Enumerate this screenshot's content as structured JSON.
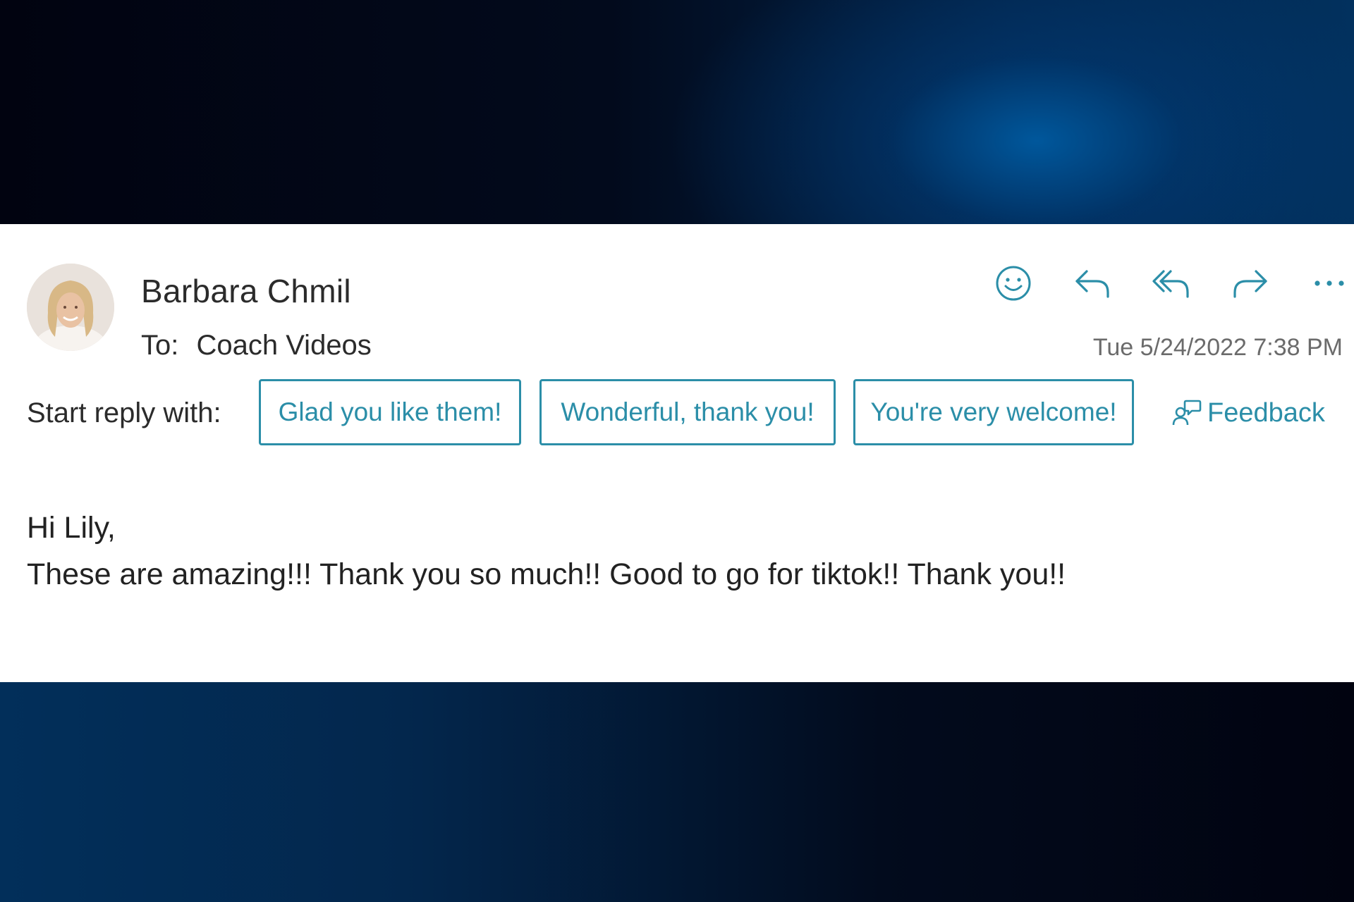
{
  "message": {
    "sender_name": "Barbara Chmil",
    "to_label": "To:",
    "to_value": "Coach Videos",
    "timestamp": "Tue 5/24/2022 7:38 PM"
  },
  "actions": [
    {
      "icon": "emoji-icon"
    },
    {
      "icon": "reply-icon"
    },
    {
      "icon": "reply-all-icon"
    },
    {
      "icon": "forward-icon"
    },
    {
      "icon": "more-options-icon"
    }
  ],
  "suggested_replies": {
    "label": "Start reply with:",
    "options": [
      "Glad you like them!",
      "Wonderful, thank you!",
      "You're very welcome!"
    ],
    "feedback_label": "Feedback"
  },
  "body": {
    "greeting": "Hi Lily,",
    "line1": "These are amazing!!! Thank you so much!! Good to go for tiktok!! Thank you!!"
  },
  "colors": {
    "accent": "#2b8ea8",
    "text": "#2b2b2b",
    "muted": "#6b6b6b"
  }
}
